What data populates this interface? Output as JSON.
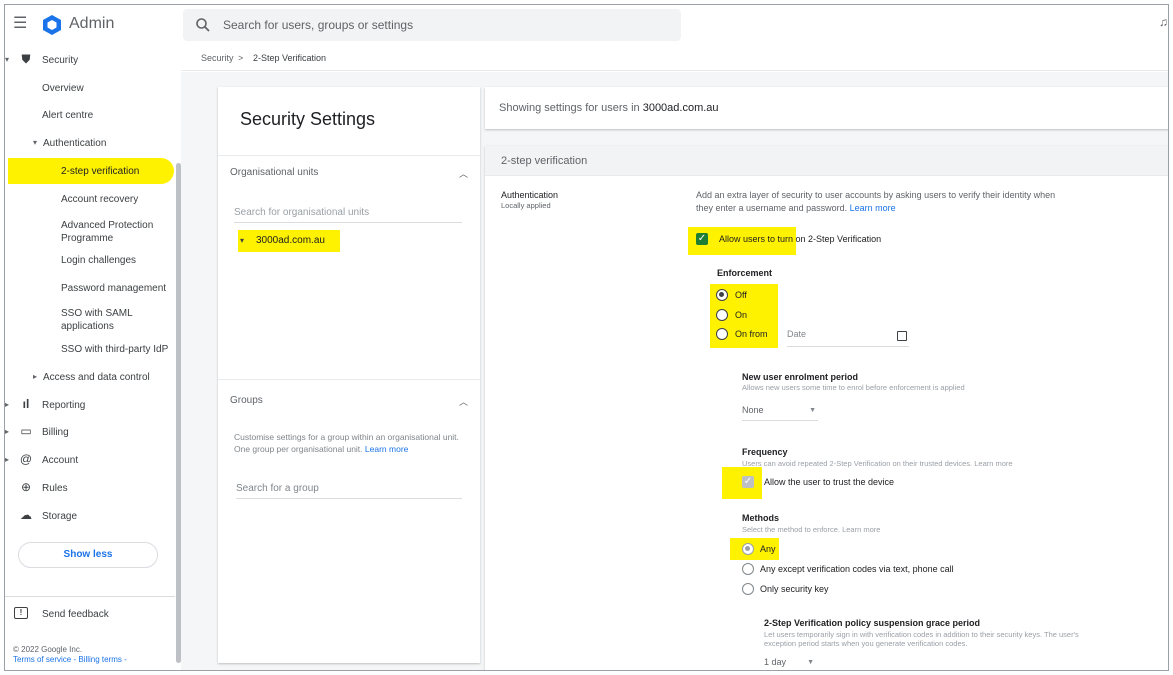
{
  "app": {
    "title": "Admin"
  },
  "search": {
    "placeholder": "Search for users, groups or settings"
  },
  "sidebar": {
    "security": "Security",
    "overview": "Overview",
    "alert_centre": "Alert centre",
    "authentication": "Authentication",
    "two_step": "2-step verification",
    "account_recovery": "Account recovery",
    "advanced_protection": "Advanced Protection Programme",
    "login_challenges": "Login challenges",
    "password_management": "Password management",
    "sso_saml": "SSO with SAML applications",
    "sso_third_party": "SSO with third-party IdP",
    "access_data_control": "Access and data control",
    "reporting": "Reporting",
    "billing": "Billing",
    "account": "Account",
    "rules": "Rules",
    "storage": "Storage",
    "show_less": "Show less",
    "send_feedback": "Send feedback",
    "copyright": "© 2022 Google Inc.",
    "terms": "Terms of service - Billing terms -"
  },
  "breadcrumb": {
    "parent": "Security",
    "separator": ">",
    "current": "2-Step Verification"
  },
  "left_panel": {
    "title": "Security Settings",
    "org_units_label": "Organisational units",
    "ou_search_placeholder": "Search for organisational units",
    "ou_item": "3000ad.com.au",
    "groups_label": "Groups",
    "groups_desc": "Customise settings for a group within an organisational unit. One group per organisational unit.",
    "groups_learn_more": "Learn more",
    "group_search_placeholder": "Search for a group"
  },
  "main": {
    "showing_prefix": "Showing settings for users in",
    "showing_domain": "3000ad.com.au",
    "section_title": "2-step verification",
    "auth_label": "Authentication",
    "auth_sub": "Locally applied",
    "desc": "Add an extra layer of security to user accounts by asking users to verify their identity when they enter a username and password.",
    "desc_learn_more": "Learn more",
    "allow_label": "Allow users to turn on 2-Step Verification",
    "enforcement_title": "Enforcement",
    "enforcement_off": "Off",
    "enforcement_on": "On",
    "enforcement_on_from": "On from",
    "date_placeholder": "Date",
    "enrolment_title": "New user enrolment period",
    "enrolment_sub": "Allows new users some time to enrol before enforcement is applied",
    "enrolment_value": "None",
    "frequency_title": "Frequency",
    "frequency_sub": "Users can avoid repeated 2-Step Verification on their trusted devices.",
    "frequency_learn_more": "Learn more",
    "trust_label": "Allow the user to trust the device",
    "methods_title": "Methods",
    "methods_sub": "Select the method to enforce.",
    "methods_learn_more": "Learn more",
    "method_any": "Any",
    "method_except": "Any except verification codes via text, phone call",
    "method_key": "Only security key",
    "grace_title": "2-Step Verification policy suspension grace period",
    "grace_sub": "Let users temporarily sign in with verification codes in addition to their security keys. The user's exception period starts when you generate verification codes.",
    "grace_value": "1 day"
  },
  "colors": {
    "highlight": "#fef200",
    "accent": "#1a73e8",
    "check": "#1e7e34"
  }
}
